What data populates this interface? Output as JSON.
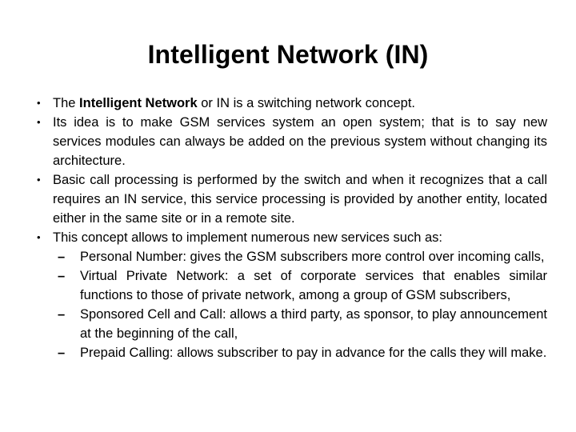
{
  "slide": {
    "title": "Intelligent Network (IN)",
    "bullets": [
      {
        "marker": "•",
        "marker_kind": "dot",
        "text_before_bold": "The ",
        "bold_text": "Intelligent Network",
        "text_after_bold": " or IN is a switching network concept.",
        "justified": false
      },
      {
        "marker": "•",
        "marker_kind": "dot",
        "text": "Its idea is to make GSM services system an open system; that is to say new services modules can always be added on the previous system without changing its architecture.",
        "justified": true
      },
      {
        "marker": "•",
        "marker_kind": "dot",
        "text": "Basic call processing is performed by the switch and when it recognizes that a call requires an IN service, this service processing is provided by another entity, located either in the same site or in a remote site.",
        "justified": true
      },
      {
        "marker": "•",
        "marker_kind": "dot",
        "text": "This concept allows to implement numerous new services such as:",
        "justified": false
      }
    ],
    "sub_bullets": [
      {
        "marker": "–",
        "text": "Personal Number: gives the GSM subscribers more control over incoming calls,",
        "justified": true
      },
      {
        "marker": "–",
        "text": "Virtual Private Network: a set of corporate services that enables similar functions to those of private network, among a group of GSM subscribers,",
        "justified": true
      },
      {
        "marker": "–",
        "text": "Sponsored Cell and Call: allows a third party, as sponsor, to play announcement at the beginning of the call,",
        "justified": true
      },
      {
        "marker": "–",
        "text": "Prepaid Calling: allows subscriber to pay in advance for the calls they will make.",
        "justified": true
      }
    ]
  },
  "colors": {
    "background": "#ffffff",
    "text": "#000000"
  }
}
